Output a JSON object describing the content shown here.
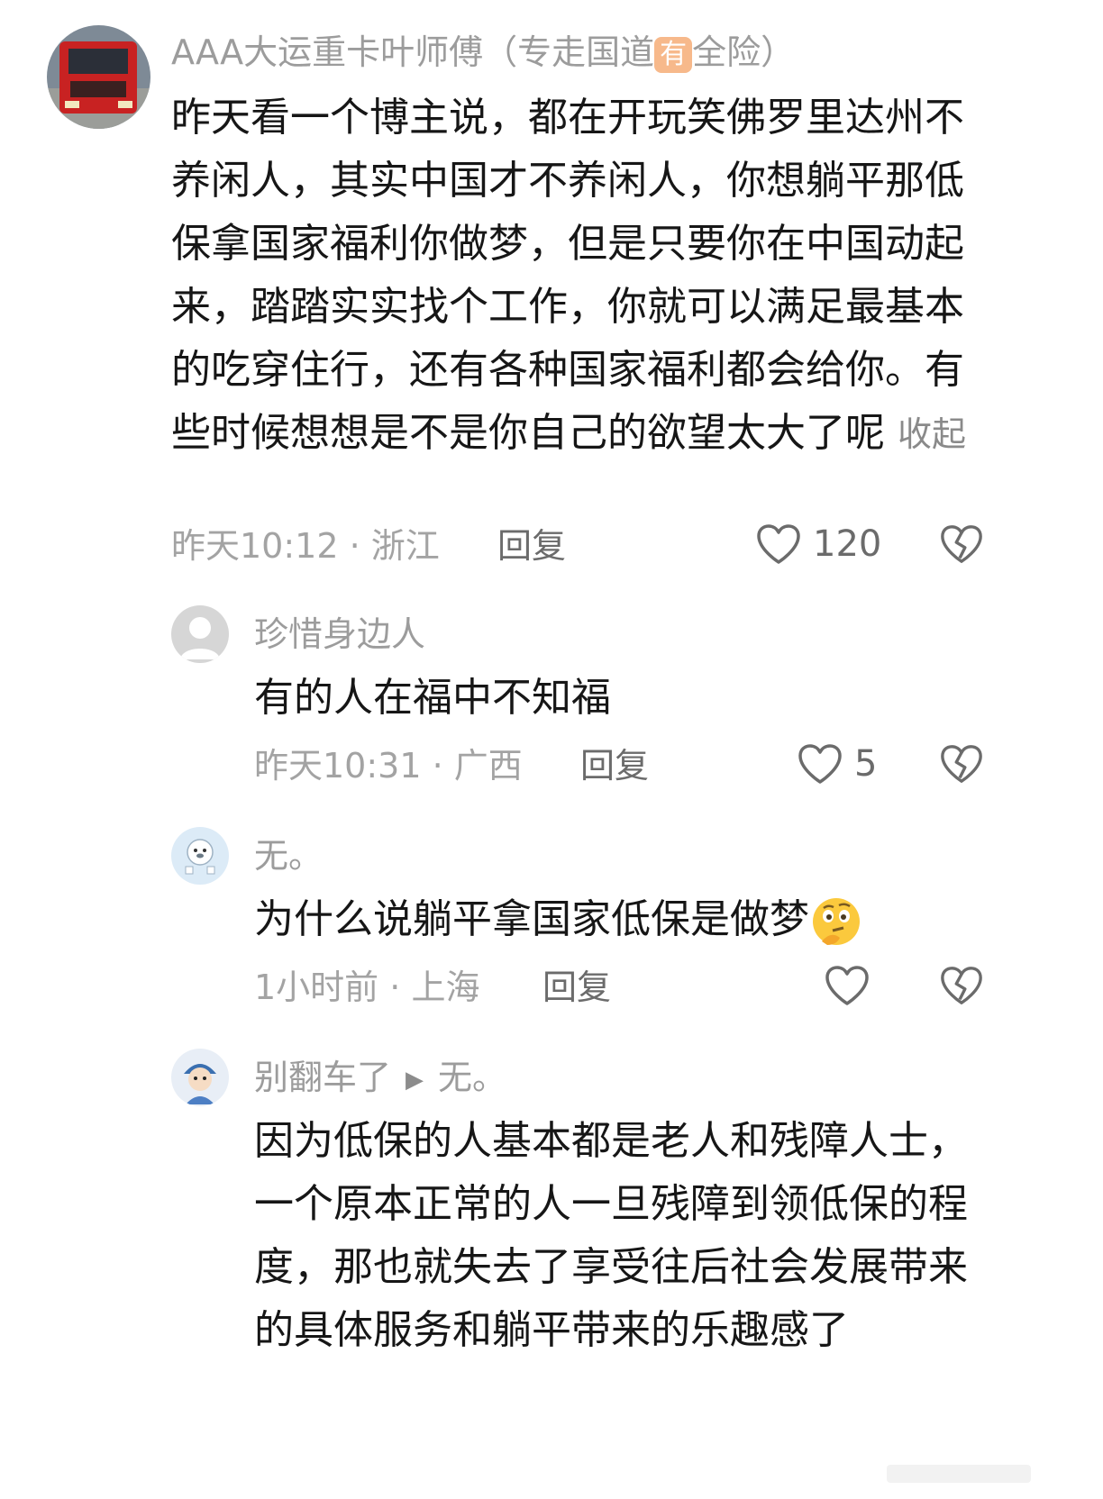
{
  "comments": [
    {
      "username": "AAA大运重卡叶师傅（专走国道",
      "username_badge": "有",
      "username_suffix": "全险）",
      "content": "昨天看一个博主说，都在开玩笑佛罗里达州不养闲人，其实中国才不养闲人，你想躺平那低保拿国家福利你做梦，但是只要你在中国动起来，踏踏实实找个工作，你就可以满足最基本的吃穿住行，还有各种国家福利都会给你。有些时候想想是不是你自己的欲望太大了呢",
      "collapse_label": "收起",
      "time": "昨天10:12",
      "location": "浙江",
      "reply_label": "回复",
      "likes": "120"
    },
    {
      "username": "珍惜身边人",
      "content": "有的人在福中不知福",
      "time": "昨天10:31",
      "location": "广西",
      "reply_label": "回复",
      "likes": "5"
    },
    {
      "username": "无。",
      "content": "为什么说躺平拿国家低保是做梦",
      "emoji": "thinking-face",
      "time": "1小时前",
      "location": "上海",
      "reply_label": "回复",
      "likes": ""
    },
    {
      "username": "别翻车了",
      "reply_to": "无。",
      "content": "因为低保的人基本都是老人和残障人士，一个原本正常的人一旦残障到领低保的程度，那也就失去了享受往后社会发展带来的具体服务和躺平带来的乐趣感了"
    }
  ],
  "colors": {
    "text": "#161616",
    "meta": "#a3a3a3",
    "badge": "#f7b98b"
  }
}
